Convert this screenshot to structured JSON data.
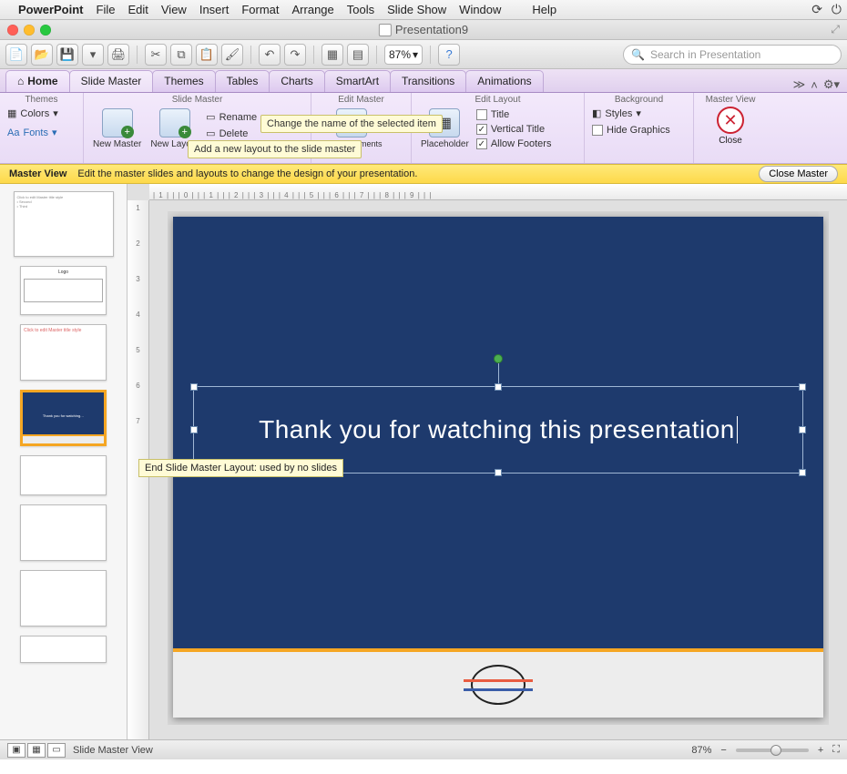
{
  "menubar": {
    "app": "PowerPoint",
    "items": [
      "File",
      "Edit",
      "View",
      "Insert",
      "Format",
      "Arrange",
      "Tools",
      "Slide Show",
      "Window"
    ],
    "help": "Help"
  },
  "window": {
    "title": "Presentation9"
  },
  "toolbar": {
    "zoom": "87%",
    "search_placeholder": "Search in Presentation"
  },
  "tabs": {
    "home": "Home",
    "items": [
      "Slide Master",
      "Themes",
      "Tables",
      "Charts",
      "SmartArt",
      "Transitions",
      "Animations"
    ],
    "overflow": "≫"
  },
  "ribbon": {
    "groups": {
      "themes": {
        "title": "Themes",
        "colors": "Colors",
        "fonts": "Fonts"
      },
      "slide_master": {
        "title": "Slide Master",
        "new_master": "New Master",
        "new_layout": "New Layout",
        "rename": "Rename",
        "delete": "Delete"
      },
      "edit_master": {
        "title": "Edit Master",
        "master_elements": "Master Elements"
      },
      "edit_layout": {
        "title": "Edit Layout",
        "placeholder": "Placeholder",
        "title_chk": "Title",
        "vert_title": "Vertical Title",
        "allow_footers": "Allow Footers"
      },
      "background": {
        "title": "Background",
        "styles": "Styles",
        "hide_graphics": "Hide Graphics"
      },
      "master_view": {
        "title": "Master View",
        "close": "Close"
      }
    },
    "tooltip_rename": "Change the name of the selected item",
    "tooltip_newlayout": "Add a new layout to the slide master"
  },
  "infobar": {
    "label": "Master View",
    "text": "Edit the master slides and layouts to change the design of your presentation.",
    "close": "Close Master"
  },
  "editor": {
    "ruler_h": "| 1 | | | 0 | | | 1 | | | 2 | | | 3 | | | 4 | | | 5 | | | 6 | | | 7 | | | 8 | | | 9 | | |",
    "ruler_v": [
      "1",
      "2",
      "3",
      "4",
      "5",
      "6",
      "7"
    ],
    "slide_text": "Thank you for watching this presentation",
    "slide_tooltip": "End Slide Master Layout: used by no slides"
  },
  "status": {
    "mode": "Slide Master View",
    "zoom": "87%"
  }
}
